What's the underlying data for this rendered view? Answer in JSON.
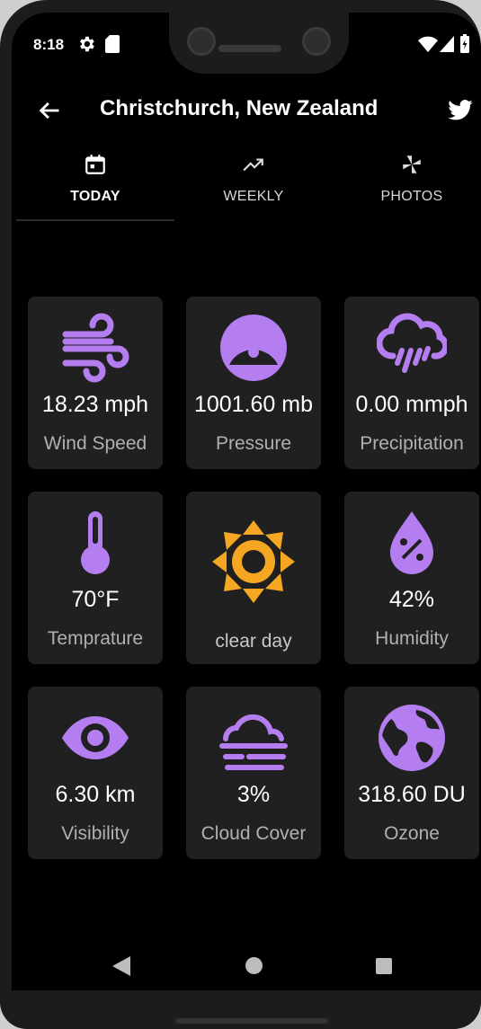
{
  "status_bar": {
    "time": "8:18",
    "icons": [
      "gear-icon",
      "sd-card-icon",
      "wifi-icon",
      "signal-icon",
      "battery-icon"
    ]
  },
  "app_bar": {
    "title": "Christchurch, New Zealand",
    "back_icon": "back-arrow-icon",
    "share_icon": "twitter-icon"
  },
  "tabs": [
    {
      "label": "TODAY",
      "icon": "calendar-icon",
      "active": true
    },
    {
      "label": "WEEKLY",
      "icon": "trending-up-icon",
      "active": false
    },
    {
      "label": "PHOTOS",
      "icon": "pinwheel-icon",
      "active": false
    }
  ],
  "tiles": [
    {
      "value": "18.23 mph",
      "label": "Wind Speed",
      "icon": "wind-icon"
    },
    {
      "value": "1001.60 mb",
      "label": "Pressure",
      "icon": "gauge-icon"
    },
    {
      "value": "0.00 mmph",
      "label": "Precipitation",
      "icon": "rain-cloud-icon"
    },
    {
      "value": "70°F",
      "label": "Temprature",
      "icon": "thermometer-icon"
    },
    {
      "value": "",
      "label": "clear day",
      "icon": "sun-icon"
    },
    {
      "value": "42%",
      "label": "Humidity",
      "icon": "humidity-drop-icon"
    },
    {
      "value": "6.30 km",
      "label": "Visibility",
      "icon": "eye-icon"
    },
    {
      "value": "3%",
      "label": "Cloud Cover",
      "icon": "cloud-fog-icon"
    },
    {
      "value": "318.60 DU",
      "label": "Ozone",
      "icon": "globe-icon"
    }
  ],
  "nav_bar": {
    "icons": [
      "nav-back-icon",
      "nav-home-icon",
      "nav-recents-icon"
    ]
  },
  "colors": {
    "accent": "#b57ef0",
    "sun": "#f5a623",
    "tile_bg": "#202020",
    "background": "#000000"
  }
}
